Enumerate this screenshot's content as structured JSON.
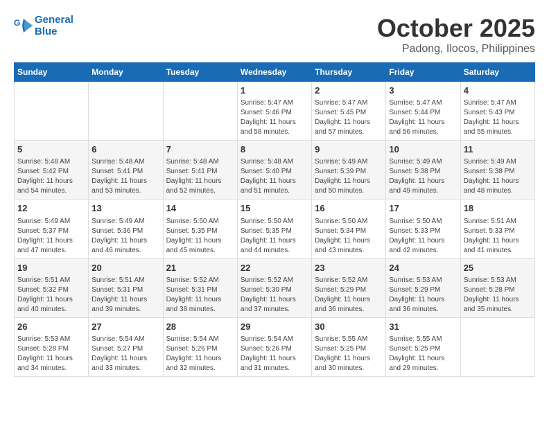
{
  "header": {
    "logo_line1": "General",
    "logo_line2": "Blue",
    "month_title": "October 2025",
    "location": "Padong, Ilocos, Philippines"
  },
  "weekdays": [
    "Sunday",
    "Monday",
    "Tuesday",
    "Wednesday",
    "Thursday",
    "Friday",
    "Saturday"
  ],
  "weeks": [
    [
      {
        "day": "",
        "info": ""
      },
      {
        "day": "",
        "info": ""
      },
      {
        "day": "",
        "info": ""
      },
      {
        "day": "1",
        "info": "Sunrise: 5:47 AM\nSunset: 5:46 PM\nDaylight: 11 hours\nand 58 minutes."
      },
      {
        "day": "2",
        "info": "Sunrise: 5:47 AM\nSunset: 5:45 PM\nDaylight: 11 hours\nand 57 minutes."
      },
      {
        "day": "3",
        "info": "Sunrise: 5:47 AM\nSunset: 5:44 PM\nDaylight: 11 hours\nand 56 minutes."
      },
      {
        "day": "4",
        "info": "Sunrise: 5:47 AM\nSunset: 5:43 PM\nDaylight: 11 hours\nand 55 minutes."
      }
    ],
    [
      {
        "day": "5",
        "info": "Sunrise: 5:48 AM\nSunset: 5:42 PM\nDaylight: 11 hours\nand 54 minutes."
      },
      {
        "day": "6",
        "info": "Sunrise: 5:48 AM\nSunset: 5:41 PM\nDaylight: 11 hours\nand 53 minutes."
      },
      {
        "day": "7",
        "info": "Sunrise: 5:48 AM\nSunset: 5:41 PM\nDaylight: 11 hours\nand 52 minutes."
      },
      {
        "day": "8",
        "info": "Sunrise: 5:48 AM\nSunset: 5:40 PM\nDaylight: 11 hours\nand 51 minutes."
      },
      {
        "day": "9",
        "info": "Sunrise: 5:49 AM\nSunset: 5:39 PM\nDaylight: 11 hours\nand 50 minutes."
      },
      {
        "day": "10",
        "info": "Sunrise: 5:49 AM\nSunset: 5:38 PM\nDaylight: 11 hours\nand 49 minutes."
      },
      {
        "day": "11",
        "info": "Sunrise: 5:49 AM\nSunset: 5:38 PM\nDaylight: 11 hours\nand 48 minutes."
      }
    ],
    [
      {
        "day": "12",
        "info": "Sunrise: 5:49 AM\nSunset: 5:37 PM\nDaylight: 11 hours\nand 47 minutes."
      },
      {
        "day": "13",
        "info": "Sunrise: 5:49 AM\nSunset: 5:36 PM\nDaylight: 11 hours\nand 46 minutes."
      },
      {
        "day": "14",
        "info": "Sunrise: 5:50 AM\nSunset: 5:35 PM\nDaylight: 11 hours\nand 45 minutes."
      },
      {
        "day": "15",
        "info": "Sunrise: 5:50 AM\nSunset: 5:35 PM\nDaylight: 11 hours\nand 44 minutes."
      },
      {
        "day": "16",
        "info": "Sunrise: 5:50 AM\nSunset: 5:34 PM\nDaylight: 11 hours\nand 43 minutes."
      },
      {
        "day": "17",
        "info": "Sunrise: 5:50 AM\nSunset: 5:33 PM\nDaylight: 11 hours\nand 42 minutes."
      },
      {
        "day": "18",
        "info": "Sunrise: 5:51 AM\nSunset: 5:33 PM\nDaylight: 11 hours\nand 41 minutes."
      }
    ],
    [
      {
        "day": "19",
        "info": "Sunrise: 5:51 AM\nSunset: 5:32 PM\nDaylight: 11 hours\nand 40 minutes."
      },
      {
        "day": "20",
        "info": "Sunrise: 5:51 AM\nSunset: 5:31 PM\nDaylight: 11 hours\nand 39 minutes."
      },
      {
        "day": "21",
        "info": "Sunrise: 5:52 AM\nSunset: 5:31 PM\nDaylight: 11 hours\nand 38 minutes."
      },
      {
        "day": "22",
        "info": "Sunrise: 5:52 AM\nSunset: 5:30 PM\nDaylight: 11 hours\nand 37 minutes."
      },
      {
        "day": "23",
        "info": "Sunrise: 5:52 AM\nSunset: 5:29 PM\nDaylight: 11 hours\nand 36 minutes."
      },
      {
        "day": "24",
        "info": "Sunrise: 5:53 AM\nSunset: 5:29 PM\nDaylight: 11 hours\nand 36 minutes."
      },
      {
        "day": "25",
        "info": "Sunrise: 5:53 AM\nSunset: 5:28 PM\nDaylight: 11 hours\nand 35 minutes."
      }
    ],
    [
      {
        "day": "26",
        "info": "Sunrise: 5:53 AM\nSunset: 5:28 PM\nDaylight: 11 hours\nand 34 minutes."
      },
      {
        "day": "27",
        "info": "Sunrise: 5:54 AM\nSunset: 5:27 PM\nDaylight: 11 hours\nand 33 minutes."
      },
      {
        "day": "28",
        "info": "Sunrise: 5:54 AM\nSunset: 5:26 PM\nDaylight: 11 hours\nand 32 minutes."
      },
      {
        "day": "29",
        "info": "Sunrise: 5:54 AM\nSunset: 5:26 PM\nDaylight: 11 hours\nand 31 minutes."
      },
      {
        "day": "30",
        "info": "Sunrise: 5:55 AM\nSunset: 5:25 PM\nDaylight: 11 hours\nand 30 minutes."
      },
      {
        "day": "31",
        "info": "Sunrise: 5:55 AM\nSunset: 5:25 PM\nDaylight: 11 hours\nand 29 minutes."
      },
      {
        "day": "",
        "info": ""
      }
    ]
  ]
}
